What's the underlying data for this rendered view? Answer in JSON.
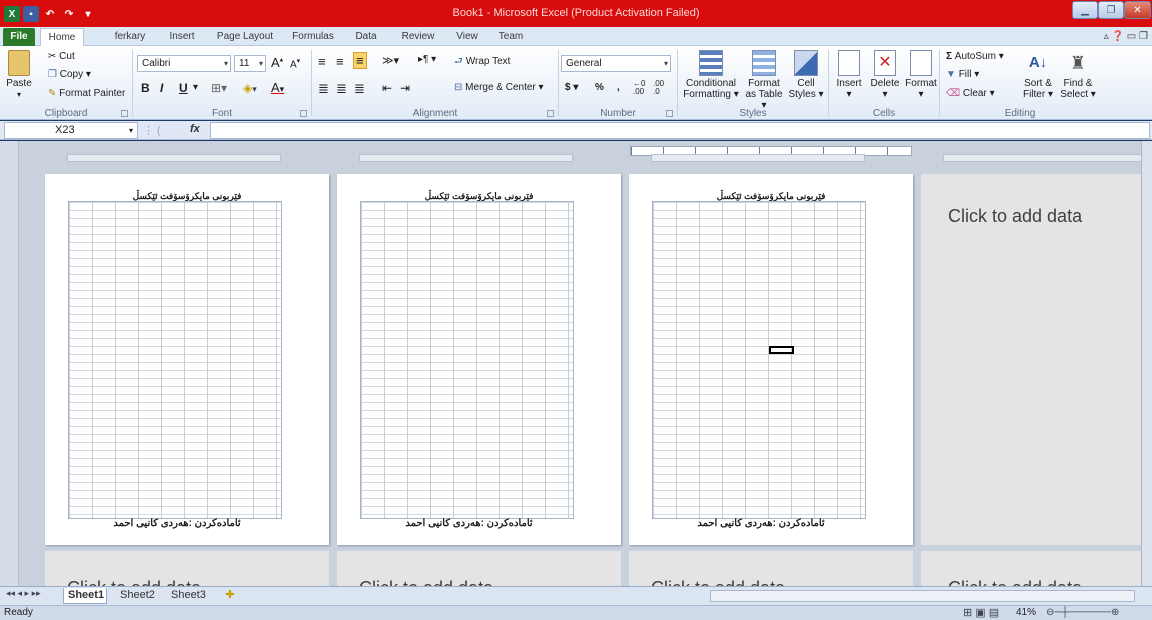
{
  "window": {
    "title": "Book1 - Microsoft Excel (Product Activation Failed)"
  },
  "tabs": [
    "File",
    "Home",
    "ferkary",
    "Insert",
    "Page Layout",
    "Formulas",
    "Data",
    "Review",
    "View",
    "Team"
  ],
  "clipboard": {
    "paste": "Paste",
    "cut": "Cut",
    "copy": "Copy",
    "format_painter": "Format Painter",
    "label": "Clipboard"
  },
  "font": {
    "name": "Calibri",
    "size": "11",
    "label": "Font",
    "bold": "B",
    "italic": "I",
    "underline": "U",
    "grow": "A",
    "shrink": "A"
  },
  "alignment": {
    "wrap": "Wrap Text",
    "merge": "Merge & Center",
    "label": "Alignment"
  },
  "number": {
    "format": "General",
    "currency": "$",
    "percent": "%",
    "comma": ",",
    "inc": ".00",
    "dec": ".0",
    "label": "Number"
  },
  "styles": {
    "cond": "Conditional",
    "cond2": "Formatting",
    "as_table": "Format",
    "as_table2": "as Table",
    "cell": "Cell",
    "cell2": "Styles",
    "label": "Styles"
  },
  "cells": {
    "insert": "Insert",
    "delete": "Delete",
    "format": "Format",
    "label": "Cells"
  },
  "editing": {
    "autosum": "AutoSum",
    "fill": "Fill",
    "clear": "Clear",
    "sort": "Sort &",
    "sort2": "Filter",
    "find": "Find &",
    "find2": "Select",
    "label": "Editing"
  },
  "formula_bar": {
    "name_box": "X23",
    "fx": "fx",
    "content": ""
  },
  "pages": [
    {
      "header": "فێربونی مایکرۆسۆفت ئێکسڵ",
      "footer": "ئامادەکردن :هەردی کانیی احمد"
    },
    {
      "header": "فێربونی مایکرۆسۆفت ئێکسڵ",
      "footer": "ئامادەکردن :هەردی کانیی احمد"
    },
    {
      "header": "فێربونی مایکرۆسۆفت ئێکسڵ",
      "footer": "ئامادەکردن :هەردی کانیی احمد"
    }
  ],
  "click_to_add": "Click to add data",
  "sheet_tabs": [
    "Sheet1",
    "Sheet2",
    "Sheet3"
  ],
  "status": {
    "ready": "Ready",
    "zoom": "41%"
  },
  "colors": {
    "title_bar": "#d80c0c",
    "file_tab": "#2b7a2b",
    "workspace": "#c9d1dc"
  }
}
